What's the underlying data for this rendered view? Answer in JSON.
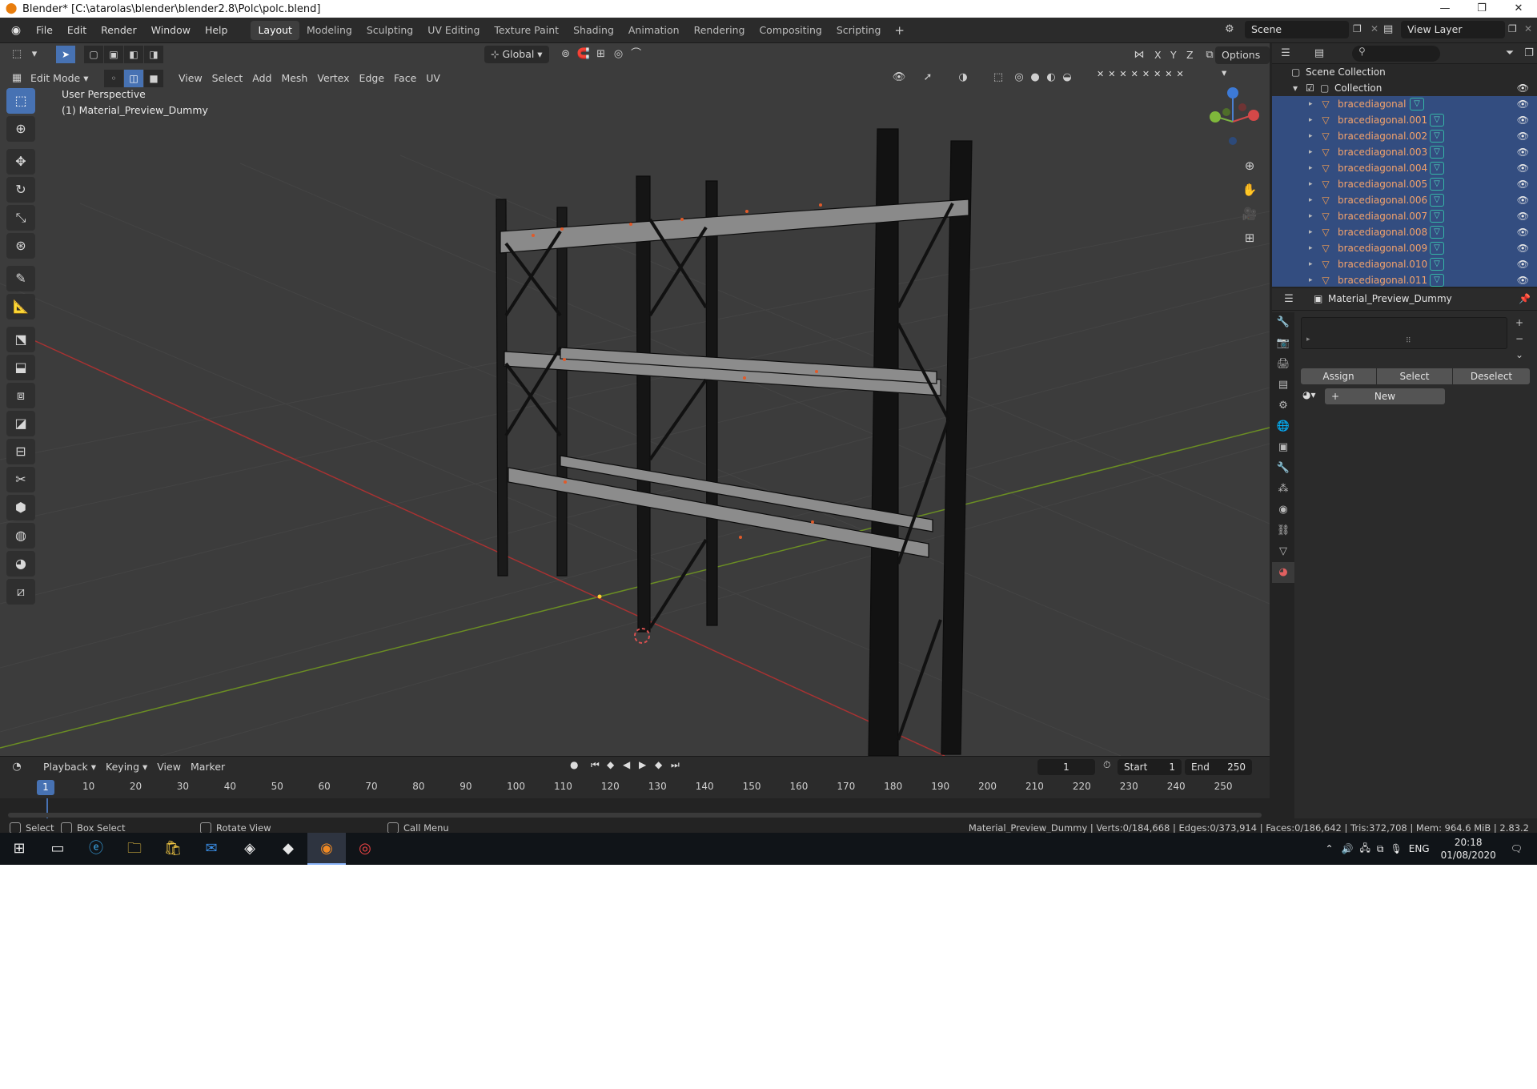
{
  "window": {
    "title": "Blender* [C:\\atarolas\\blender\\blender2.8\\Polc\\polc.blend]",
    "controls": [
      "—",
      "❐",
      "✕"
    ]
  },
  "menu": [
    "File",
    "Edit",
    "Render",
    "Window",
    "Help"
  ],
  "workspaces": [
    "Layout",
    "Modeling",
    "Sculpting",
    "UV Editing",
    "Texture Paint",
    "Shading",
    "Animation",
    "Rendering",
    "Compositing",
    "Scripting"
  ],
  "active_workspace": "Layout",
  "scene": "Scene",
  "view_layer": "View Layer",
  "viewport": {
    "mode": "Edit Mode",
    "menus": [
      "View",
      "Select",
      "Add",
      "Mesh",
      "Vertex",
      "Edge",
      "Face",
      "UV"
    ],
    "transform_orientation": "Global",
    "axes": [
      "X",
      "Y",
      "Z"
    ],
    "options_label": "Options",
    "perspective_label": "User Perspective",
    "object_label": "(1) Material_Preview_Dummy"
  },
  "tools": [
    "select-box",
    "cursor",
    "move",
    "rotate",
    "scale",
    "transform",
    "annotate",
    "measure",
    "add-cube",
    "extrude",
    "inset",
    "bevel",
    "loop-cut",
    "knife",
    "poly-build",
    "spin",
    "smooth",
    "edge-slide",
    "shrink-fatten",
    "shear",
    "rip"
  ],
  "timeline": {
    "menus": [
      "Playback",
      "Keying",
      "View",
      "Marker"
    ],
    "current_frame": "1",
    "start_label": "Start",
    "start": "1",
    "end_label": "End",
    "end": "250",
    "ticks": [
      "10",
      "20",
      "30",
      "40",
      "50",
      "60",
      "70",
      "80",
      "90",
      "100",
      "110",
      "120",
      "130",
      "140",
      "150",
      "160",
      "170",
      "180",
      "190",
      "200",
      "210",
      "220",
      "230",
      "240",
      "250"
    ],
    "cursor_frame": "1"
  },
  "statusbar": {
    "select": "Select",
    "box_select": "Box Select",
    "rotate_view": "Rotate View",
    "call_menu": "Call Menu",
    "stats": "Material_Preview_Dummy | Verts:0/184,668 | Edges:0/373,914 | Faces:0/186,642 | Tris:372,708 | Mem: 964.6 MiB | 2.83.2"
  },
  "outliner": {
    "root": "Scene Collection",
    "collection": "Collection",
    "items": [
      "bracediagonal",
      "bracediagonal.001",
      "bracediagonal.002",
      "bracediagonal.003",
      "bracediagonal.004",
      "bracediagonal.005",
      "bracediagonal.006",
      "bracediagonal.007",
      "bracediagonal.008",
      "bracediagonal.009",
      "bracediagonal.010",
      "bracediagonal.011"
    ]
  },
  "properties": {
    "object_name": "Material_Preview_Dummy",
    "assign": "Assign",
    "select": "Select",
    "deselect": "Deselect",
    "new": "New"
  },
  "taskbar": {
    "language": "ENG",
    "time": "20:18",
    "date": "01/08/2020"
  }
}
